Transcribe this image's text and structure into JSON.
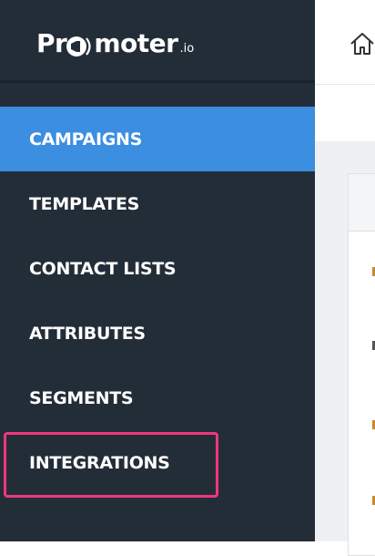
{
  "app": {
    "logo_text": "Promoter.io",
    "logo_prefix": "Pr",
    "logo_suffix": "moter",
    "logo_tld": ".io"
  },
  "sidebar": {
    "items": [
      {
        "label": "CAMPAIGNS",
        "active": true
      },
      {
        "label": "TEMPLATES",
        "active": false
      },
      {
        "label": "CONTACT LISTS",
        "active": false
      },
      {
        "label": "ATTRIBUTES",
        "active": false
      },
      {
        "label": "SEGMENTS",
        "active": false
      },
      {
        "label": "INTEGRATIONS",
        "active": false,
        "highlighted": true
      }
    ]
  },
  "topbar": {
    "icon": "home-icon"
  },
  "colors": {
    "sidebar_bg": "#232d38",
    "active_item": "#3b8ee0",
    "highlight_border": "#f0377a"
  }
}
